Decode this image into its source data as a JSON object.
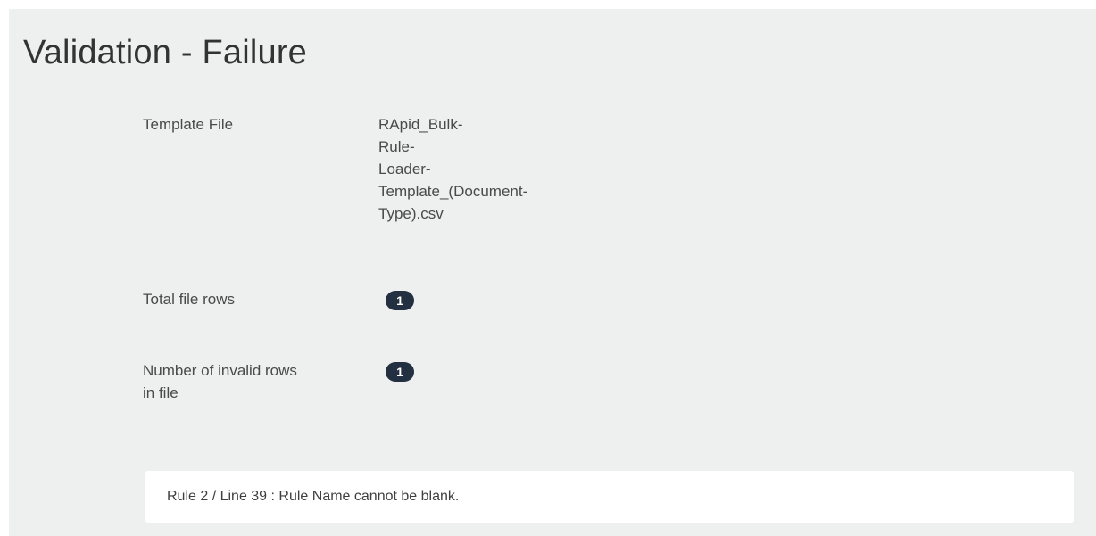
{
  "page": {
    "title": "Validation - Failure"
  },
  "summary": {
    "template_file": {
      "label": "Template File",
      "value_lines": [
        "RApid_Bulk-",
        "Rule-",
        "Loader-",
        "Template_(Document-",
        "Type).csv"
      ]
    },
    "total_rows": {
      "label": "Total file rows",
      "value": "1"
    },
    "invalid_rows": {
      "label_lines": [
        "Number of invalid rows",
        "in file"
      ],
      "value": "1"
    }
  },
  "errors": [
    "Rule 2 / Line 39 : Rule Name cannot be blank."
  ],
  "colors": {
    "panel_background": "#edf0ef",
    "badge_background": "#233041",
    "error_box_background": "#ffffff"
  }
}
